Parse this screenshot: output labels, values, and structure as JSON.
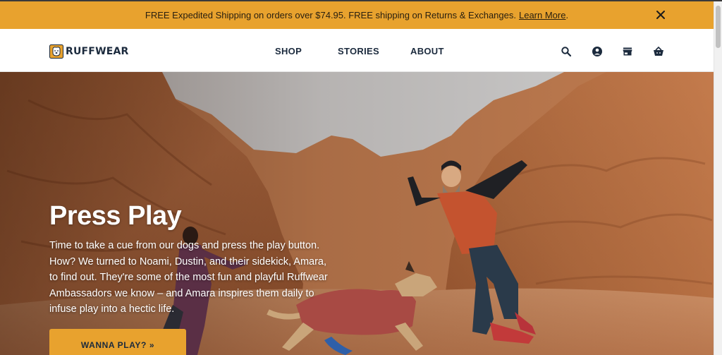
{
  "promo": {
    "text": "FREE Expedited Shipping on orders over $74.95. FREE shipping on Returns & Exchanges.",
    "link_label": "Learn More",
    "trailing": ".",
    "close_icon": "close-icon"
  },
  "header": {
    "brand": "RUFFWEAR",
    "nav": {
      "shop": "SHOP",
      "stories": "STORIES",
      "about": "ABOUT"
    },
    "icons": [
      "search-icon",
      "account-icon",
      "store-icon",
      "cart-icon"
    ]
  },
  "hero": {
    "title": "Press Play",
    "body": "Time to take a cue from our dogs and press the play button. How? We turned to Noami, Dustin, and their sidekick, Amara, to find out. They're some of the most fun and playful Ruffwear Ambassadors we know – and Amara inspires them daily to infuse play into a hectic life.",
    "cta_label": "WANNA PLAY? »"
  },
  "colors": {
    "promo_bg": "#e8a22e",
    "navy": "#1b2a3d",
    "canyon": "#b56a3d"
  }
}
